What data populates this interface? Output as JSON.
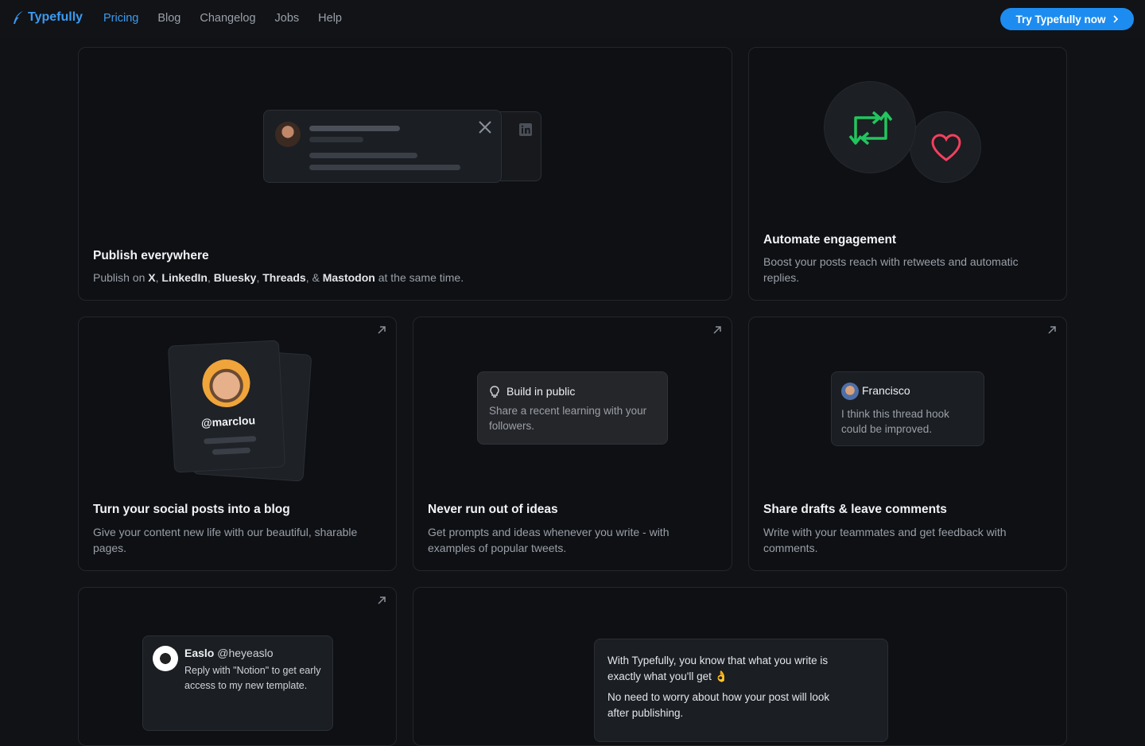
{
  "nav": {
    "brand": "Typefully",
    "links": [
      "Pricing",
      "Blog",
      "Changelog",
      "Jobs",
      "Help"
    ],
    "cta": "Try Typefully now"
  },
  "cards": {
    "publish": {
      "title": "Publish everywhere",
      "desc_prefix": "Publish on ",
      "platforms": [
        "X",
        "LinkedIn",
        "Bluesky",
        "Threads",
        "Mastodon"
      ],
      "desc_suffix": " at the same time.",
      "sep1": ", ",
      "sep_amp": ", & "
    },
    "engagement": {
      "title": "Automate engagement",
      "desc": "Boost your posts reach with retweets and automatic replies."
    },
    "blog": {
      "title": "Turn your social posts into a blog",
      "desc": "Give your content new life with our beautiful, sharable pages.",
      "handle": "@marclou"
    },
    "ideas": {
      "title": "Never run out of ideas",
      "desc": "Get prompts and ideas whenever you write - with examples of popular tweets.",
      "prompt_title": "Build in public",
      "prompt_text": "Share a recent learning with your followers."
    },
    "drafts": {
      "title": "Share drafts & leave comments",
      "desc": "Write with your teammates and get feedback with comments.",
      "commenter": "Francisco",
      "comment": "I think this thread hook could be improved."
    },
    "autoreply": {
      "name": "Easlo",
      "handle": "@heyeaslo",
      "text": "Reply with \"Notion\" to get early access to my new template."
    },
    "preview": {
      "line1": "With Typefully, you know that what you write is exactly what you'll get 👌",
      "line2": "No need to worry about how your post will look after publishing."
    }
  },
  "colors": {
    "accent": "#1d8cf0",
    "retweet": "#22c55e",
    "heart": "#f43f5e"
  }
}
